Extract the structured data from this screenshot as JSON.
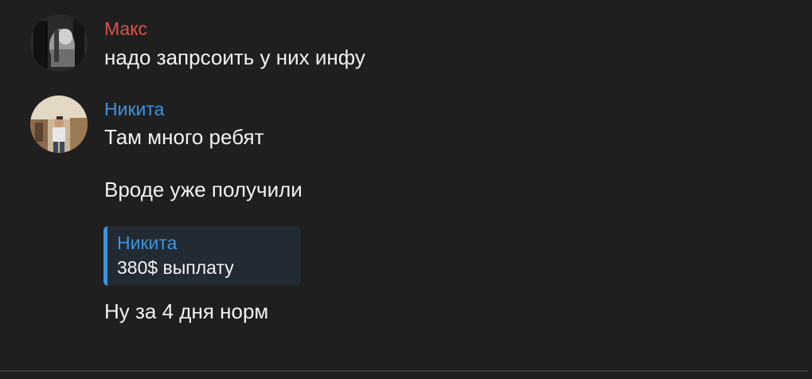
{
  "colors": {
    "background": "#1f1f1f",
    "maks_name": "#d9534a",
    "nikita_name": "#3e93dd",
    "quote_accent": "#3e93dd",
    "message_text": "#f2f2f2"
  },
  "messages": [
    {
      "sender": "Макс",
      "lines": [
        "надо запрсоить у них инфу"
      ]
    },
    {
      "sender": "Никита",
      "lines": [
        "Там много ребят",
        "Вроде уже получили"
      ],
      "quote": {
        "author": "Никита",
        "text": "380$ выплату"
      },
      "after_quote": "Ну за 4 дня норм"
    }
  ]
}
